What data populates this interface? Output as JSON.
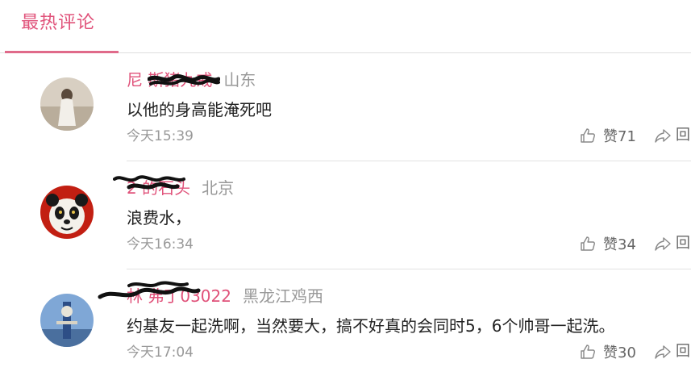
{
  "tab": {
    "title": "最热评论"
  },
  "comments": [
    {
      "author": "尼 斯猪九戒",
      "location": "山东",
      "text": "以他的身高能淹死吧",
      "time": "今天15:39",
      "like_label": "赞71",
      "reply_partial": "回"
    },
    {
      "author": "2 的石头",
      "location": "北京",
      "text": "浪费水，",
      "time": "今天16:34",
      "like_label": "赞34",
      "reply_partial": "回"
    },
    {
      "author": "林 弗丁03022",
      "location": "黑龙江鸡西",
      "text": "约基友一起洗啊，当然要大，搞不好真的会同时5，6个帅哥一起洗。",
      "time": "今天17:04",
      "like_label": "赞30",
      "reply_partial": "回"
    }
  ],
  "colors": {
    "accent": "#e0527a",
    "muted": "#999999",
    "text": "#222222"
  },
  "icons": {
    "like": "thumbs-up-icon",
    "reply": "share-arrow-icon"
  }
}
